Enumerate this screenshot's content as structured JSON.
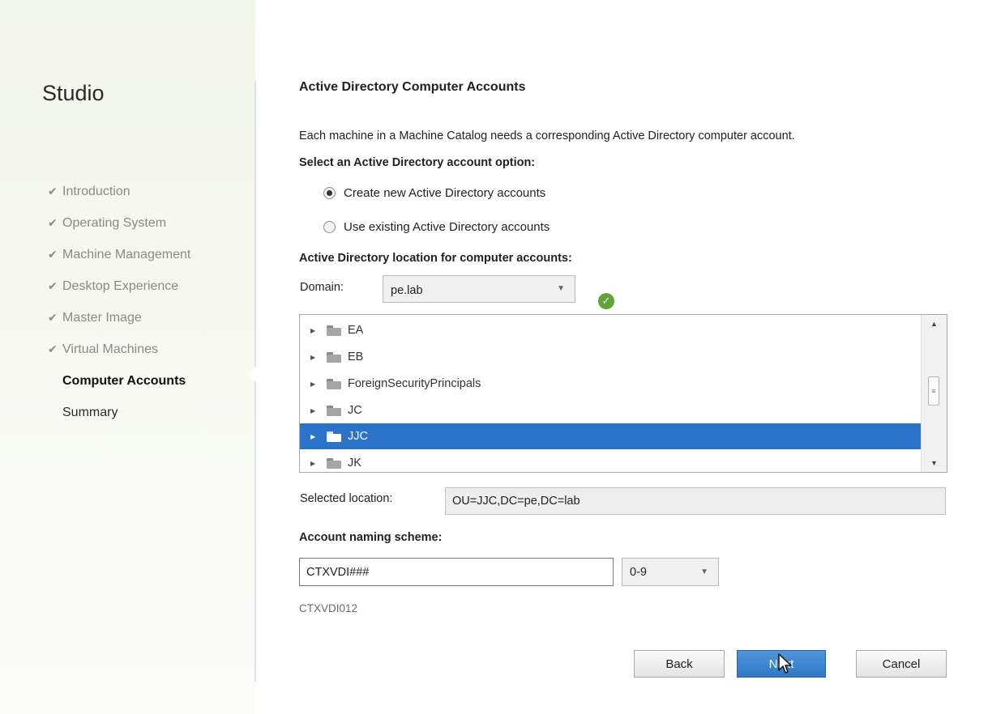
{
  "sidebar": {
    "title": "Studio",
    "steps": [
      {
        "label": "Introduction",
        "state": "done"
      },
      {
        "label": "Operating System",
        "state": "done"
      },
      {
        "label": "Machine Management",
        "state": "done"
      },
      {
        "label": "Desktop Experience",
        "state": "done"
      },
      {
        "label": "Master Image",
        "state": "done"
      },
      {
        "label": "Virtual Machines",
        "state": "done"
      },
      {
        "label": "Computer Accounts",
        "state": "current"
      },
      {
        "label": "Summary",
        "state": "pending"
      }
    ],
    "check_glyph": "✔"
  },
  "main": {
    "title": "Active Directory Computer Accounts",
    "description": "Each machine in a Machine Catalog needs a corresponding Active Directory computer account.",
    "option_prompt": "Select an Active Directory account option:",
    "options": [
      {
        "label": "Create new Active Directory accounts",
        "selected": true
      },
      {
        "label": "Use existing Active Directory accounts",
        "selected": false
      }
    ],
    "location_heading": "Active Directory location for computer accounts:",
    "domain_label": "Domain:",
    "domain_value": "pe.lab",
    "domain_status_icon": "check-circle-icon",
    "tree_items": [
      {
        "label": "EA",
        "selected": false
      },
      {
        "label": "EB",
        "selected": false
      },
      {
        "label": "ForeignSecurityPrincipals",
        "selected": false
      },
      {
        "label": "JC",
        "selected": false
      },
      {
        "label": "JJC",
        "selected": true
      },
      {
        "label": "JK",
        "selected": false
      }
    ],
    "selected_location_label": "Selected location:",
    "selected_location_value": "OU=JJC,DC=pe,DC=lab",
    "naming_label": "Account naming scheme:",
    "naming_value": "CTXVDI###",
    "naming_type": "0-9",
    "naming_preview": "CTXVDI012"
  },
  "buttons": {
    "back": "Back",
    "next": "Next",
    "cancel": "Cancel"
  },
  "colors": {
    "accent": "#2a73c9",
    "ok": "#5fa43a"
  }
}
